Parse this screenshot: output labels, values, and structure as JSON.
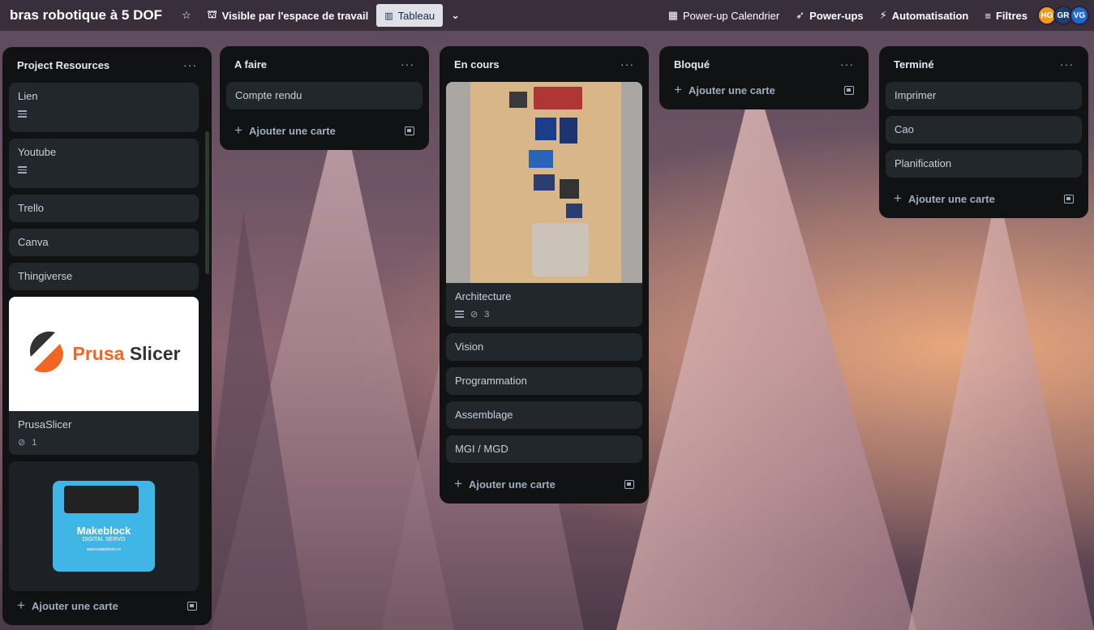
{
  "board": {
    "title": "bras robotique à 5 DOF",
    "visibility": "Visible par l'espace de travail",
    "view": "Tableau"
  },
  "toolbar": {
    "calendar": "Power-up Calendrier",
    "powerups": "Power-ups",
    "automation": "Automatisation",
    "filters": "Filtres"
  },
  "members": [
    {
      "initials": "HG",
      "color": "#f29a1f"
    },
    {
      "initials": "GR",
      "color": "#1f3f73"
    },
    {
      "initials": "VG",
      "color": "#1d67d6"
    }
  ],
  "lists": {
    "resources": {
      "title": "Project Resources",
      "cards": [
        "Lien",
        "Youtube",
        "Trello",
        "Canva",
        "Thingiverse"
      ],
      "prusa": {
        "title": "PrusaSlicer",
        "attachments": "1",
        "logo_text_a": "Prusa",
        "logo_text_b": "Slicer"
      },
      "makeblock": {
        "brand": "Makeblock",
        "sub": "DIGITAL SERVO",
        "url": "www.makeblock.cc"
      },
      "add": "Ajouter une carte"
    },
    "todo": {
      "title": "A faire",
      "cards": [
        "Compte rendu"
      ],
      "add": "Ajouter une carte"
    },
    "doing": {
      "title": "En cours",
      "cover_card": {
        "title": "Architecture",
        "attachments": "3"
      },
      "cards": [
        "Vision",
        "Programmation",
        "Assemblage",
        "MGI / MGD"
      ],
      "add": "Ajouter une carte"
    },
    "blocked": {
      "title": "Bloqué",
      "add": "Ajouter une carte"
    },
    "done": {
      "title": "Terminé",
      "cards": [
        "Imprimer",
        "Cao",
        "Planification"
      ],
      "add": "Ajouter une carte"
    }
  },
  "menu_glyph": "···"
}
